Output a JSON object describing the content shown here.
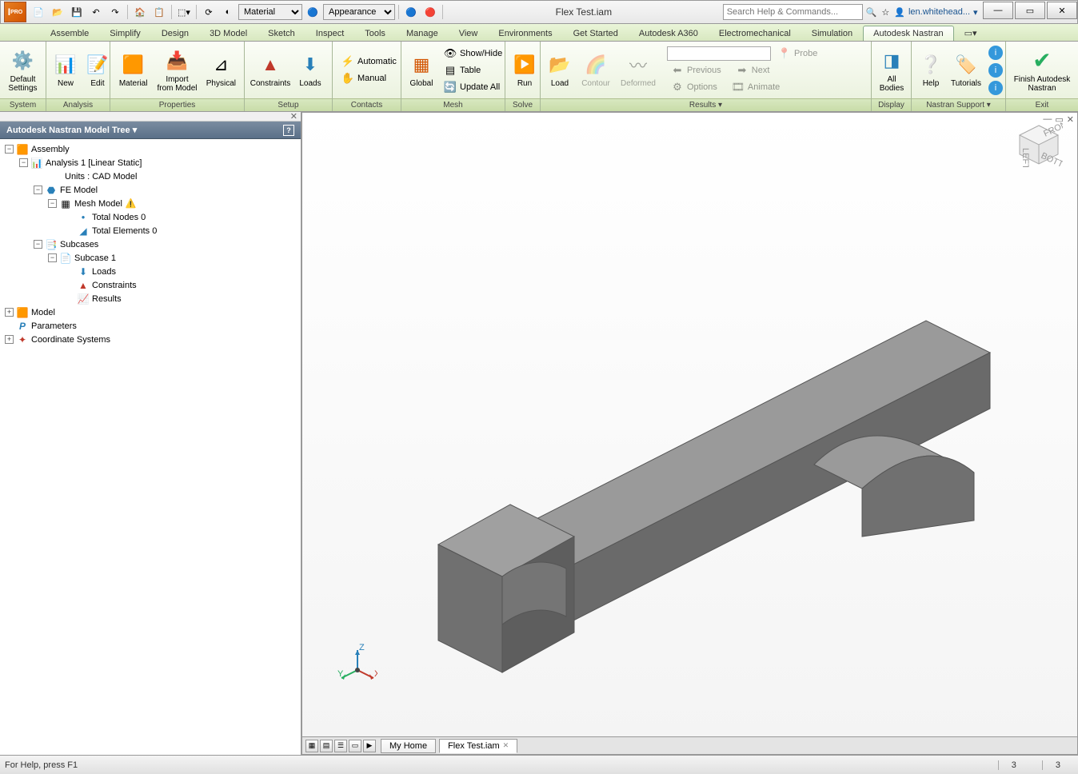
{
  "app": {
    "name": "Autodesk Inventor",
    "doc_title": "Flex Test.iam",
    "pro_label": "PRO"
  },
  "search": {
    "placeholder": "Search Help & Commands..."
  },
  "user": {
    "name": "len.whitehead..."
  },
  "qat": {
    "material_label": "Material",
    "appearance_label": "Appearance"
  },
  "tabs": [
    "Assemble",
    "Simplify",
    "Design",
    "3D Model",
    "Sketch",
    "Inspect",
    "Tools",
    "Manage",
    "View",
    "Environments",
    "Get Started",
    "Autodesk A360",
    "Electromechanical",
    "Simulation",
    "Autodesk Nastran"
  ],
  "active_tab": "Autodesk Nastran",
  "ribbon": {
    "system": {
      "label": "System",
      "default_settings": "Default Settings"
    },
    "analysis": {
      "label": "Analysis",
      "new": "New",
      "edit": "Edit"
    },
    "properties": {
      "label": "Properties",
      "material": "Material",
      "import_from_model": "Import from Model",
      "physical": "Physical"
    },
    "setup": {
      "label": "Setup",
      "constraints": "Constraints",
      "loads": "Loads"
    },
    "contacts": {
      "label": "Contacts",
      "automatic": "Automatic",
      "manual": "Manual"
    },
    "mesh": {
      "label": "Mesh",
      "global": "Global",
      "show_hide": "Show/Hide",
      "table": "Table",
      "update_all": "Update All"
    },
    "solve": {
      "label": "Solve",
      "run": "Run"
    },
    "results": {
      "label": "Results ▾",
      "load": "Load",
      "contour": "Contour",
      "deformed": "Deformed",
      "probe": "Probe",
      "previous": "Previous",
      "next": "Next",
      "options": "Options",
      "animate": "Animate"
    },
    "display": {
      "label": "Display",
      "all_bodies": "All Bodies"
    },
    "support": {
      "label": "Nastran Support ▾",
      "help": "Help",
      "tutorials": "Tutorials"
    },
    "exit": {
      "label": "Exit",
      "finish": "Finish Autodesk Nastran"
    }
  },
  "tree": {
    "title": "Autodesk Nastran Model Tree ▾",
    "assembly": "Assembly",
    "analysis": "Analysis 1 [Linear Static]",
    "units": "Units : CAD Model",
    "fe_model": "FE Model",
    "mesh_model": "Mesh Model",
    "total_nodes": "Total Nodes 0",
    "total_elements": "Total Elements 0",
    "subcases": "Subcases",
    "subcase1": "Subcase 1",
    "loads": "Loads",
    "constraints": "Constraints",
    "results": "Results",
    "model": "Model",
    "parameters": "Parameters",
    "coord_systems": "Coordinate Systems"
  },
  "doc_tabs": {
    "home": "My Home",
    "current": "Flex Test.iam"
  },
  "status": {
    "help": "For Help, press F1",
    "num1": "3",
    "num2": "3"
  }
}
